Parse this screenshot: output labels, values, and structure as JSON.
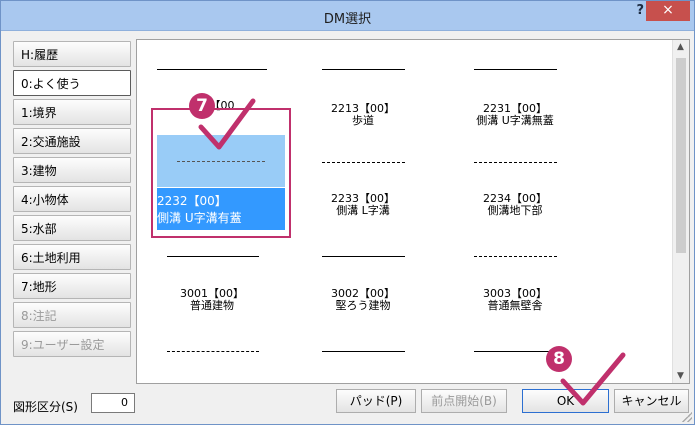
{
  "window": {
    "title": "DM選択",
    "help_glyph": "?",
    "close_glyph": "×"
  },
  "sidebar": {
    "items": [
      {
        "key": "H",
        "label": "H:履歴"
      },
      {
        "key": "0",
        "label": "0:よく使う"
      },
      {
        "key": "1",
        "label": "1:境界"
      },
      {
        "key": "2",
        "label": "2:交通施設"
      },
      {
        "key": "3",
        "label": "3:建物"
      },
      {
        "key": "4",
        "label": "4:小物体"
      },
      {
        "key": "5",
        "label": "5:水部"
      },
      {
        "key": "6",
        "label": "6:土地利用"
      },
      {
        "key": "7",
        "label": "7:地形"
      },
      {
        "key": "8",
        "label": "8:注記"
      },
      {
        "key": "9",
        "label": "9:ユーザー設定"
      }
    ]
  },
  "grid": {
    "items": [
      {
        "code": "2213【00】",
        "name": "歩道"
      },
      {
        "code": "2231【00】",
        "name": "側溝 U字溝無蓋"
      },
      {
        "code": "2232【00】",
        "name": "側溝 U字溝有蓋"
      },
      {
        "code": "2233【00】",
        "name": "側溝 L字溝"
      },
      {
        "code": "2234【00】",
        "name": "側溝地下部"
      },
      {
        "code": "3001【00】",
        "name": "普通建物"
      },
      {
        "code": "3002【00】",
        "name": "堅ろう建物"
      },
      {
        "code": "3003【00】",
        "name": "普通無壁舎"
      }
    ],
    "selected_code": "2232【00】",
    "partial_top_label": "【00"
  },
  "annotations": {
    "step7": "7",
    "step8": "8"
  },
  "footer": {
    "shape_label": "図形区分(S)",
    "shape_value": "0",
    "pad_button": "パッド(P)",
    "start_point_button": "前点開始(B)",
    "ok_button": "OK",
    "cancel_button": "キャンセル"
  },
  "colors": {
    "titlebar": "#a9c8ef",
    "close": "#c7504d",
    "accent": "#c0306c",
    "selection": "#3399ff"
  }
}
